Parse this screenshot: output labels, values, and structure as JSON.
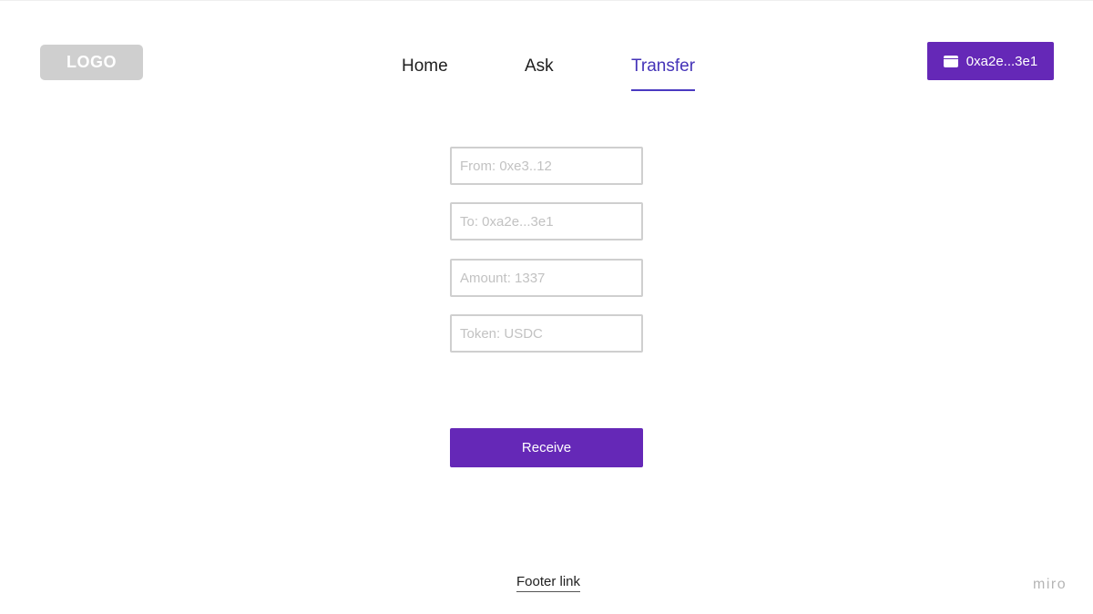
{
  "header": {
    "logo_text": "LOGO",
    "nav": {
      "home": "Home",
      "ask": "Ask",
      "transfer": "Transfer",
      "active": "Transfer"
    },
    "wallet": {
      "icon": "wallet-icon",
      "address": "0xa2e...3e1"
    }
  },
  "form": {
    "from_placeholder": "From: 0xe3..12",
    "to_placeholder": "To: 0xa2e...3e1",
    "amount_placeholder": "Amount: 1337",
    "token_placeholder": "Token: USDC",
    "submit_label": "Receive"
  },
  "footer": {
    "link_label": "Footer link"
  },
  "watermark": "miro",
  "colors": {
    "accent": "#6528b7",
    "nav_active": "#4433b8",
    "logo_bg": "#cfcfcf",
    "input_border": "#cfcfcf"
  }
}
